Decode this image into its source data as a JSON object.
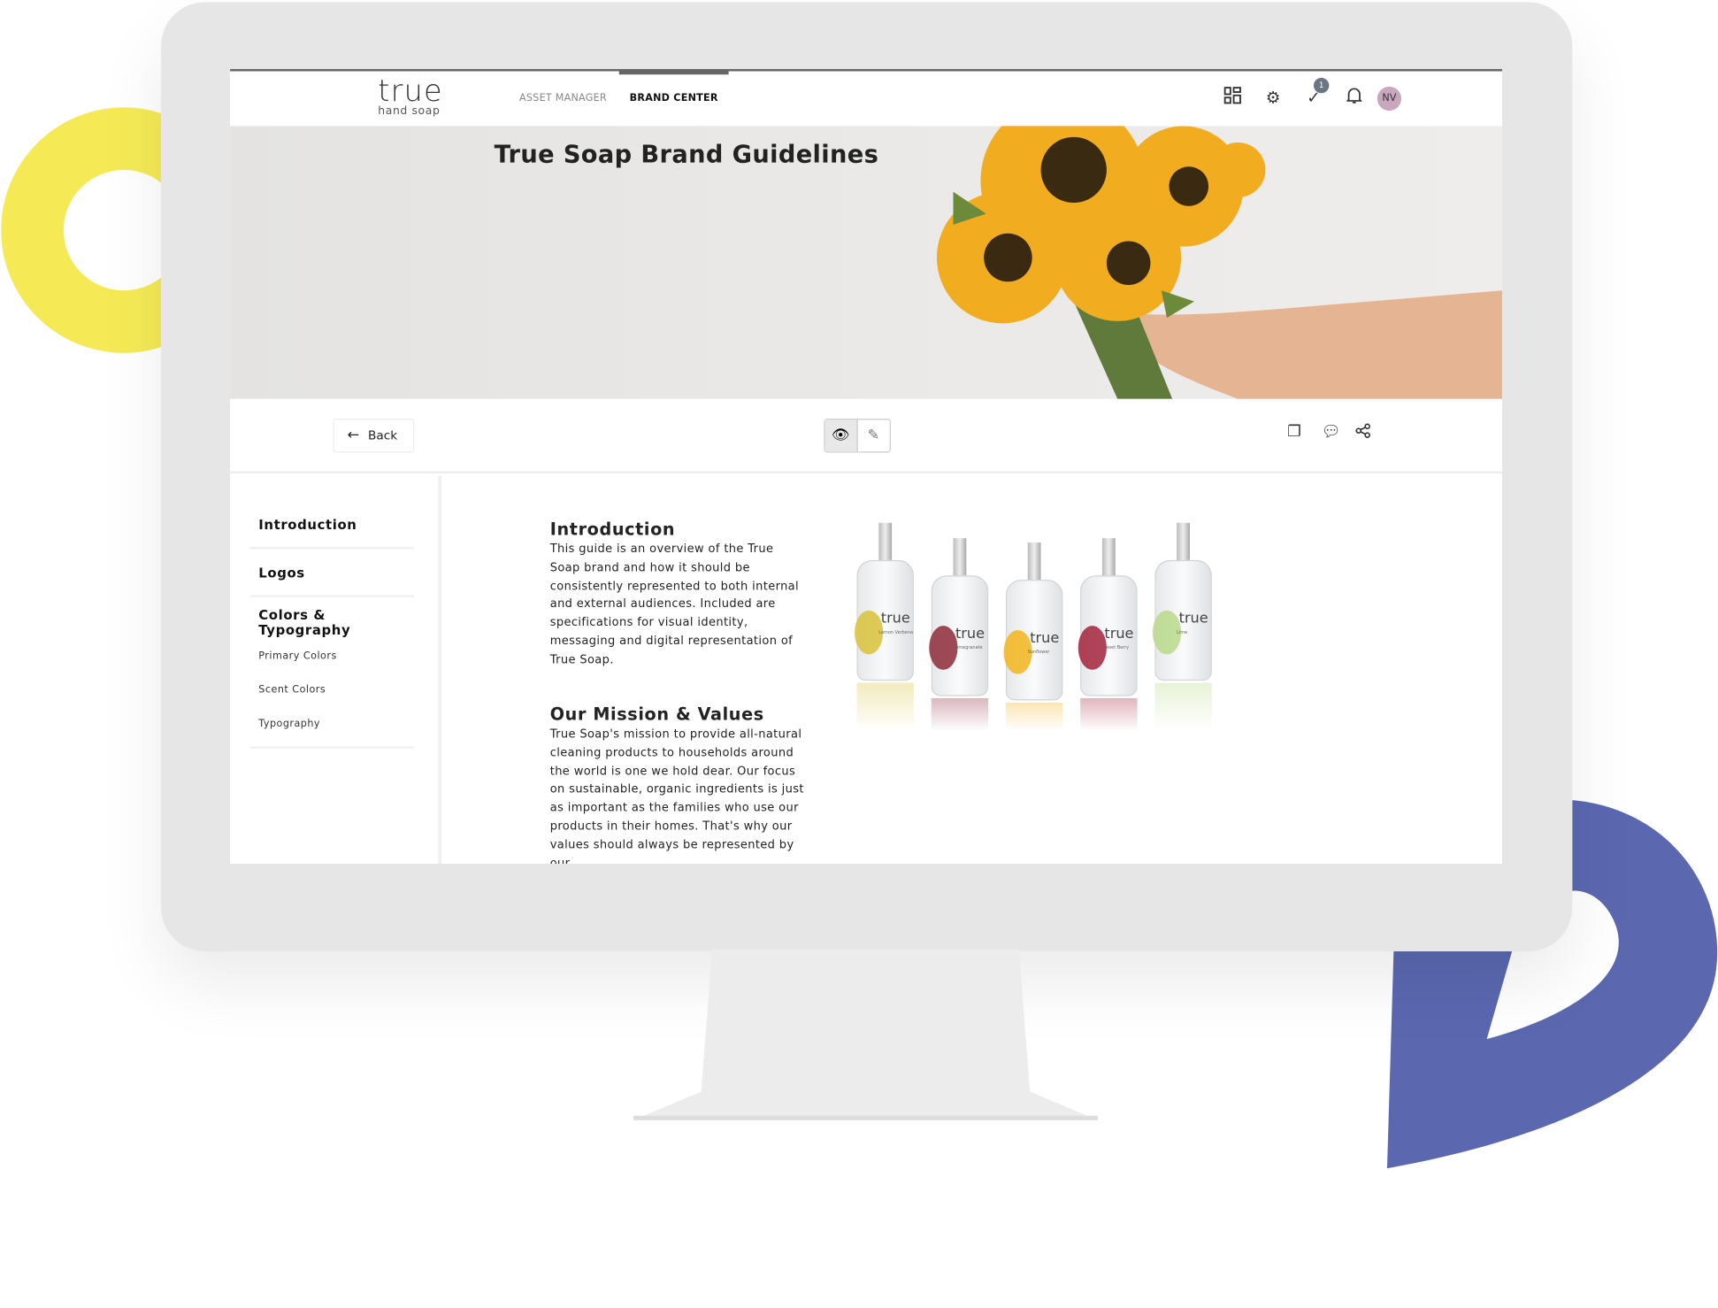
{
  "header": {
    "logo_word": "true",
    "logo_sub": "hand soap",
    "nav": [
      {
        "label": "ASSET MANAGER",
        "active": false
      },
      {
        "label": "BRAND CENTER",
        "active": true
      }
    ],
    "icons": [
      "apps-grid-icon",
      "gear-icon",
      "tasks-check-icon",
      "bell-icon"
    ],
    "tasks_badge": "1",
    "avatar_initials": "NV"
  },
  "hero": {
    "title": "True Soap Brand Guidelines"
  },
  "toolbar": {
    "back_label": "Back",
    "view_mode": "view",
    "icons": [
      "eye-icon",
      "pencil-icon",
      "copy-icon",
      "comment-icon",
      "share-icon"
    ]
  },
  "sidebar": {
    "items": [
      {
        "label": "Introduction"
      },
      {
        "label": "Logos"
      },
      {
        "label": "Colors & Typography",
        "children": [
          "Primary Colors",
          "Scent Colors",
          "Typography"
        ]
      }
    ]
  },
  "content": {
    "sections": [
      {
        "title": "Introduction",
        "body": "This guide is an overview of the True Soap brand and how it should be consistently represented to both internal and external audiences. Included are specifications for visual identity, messaging and digital representation of True Soap."
      },
      {
        "title": "Our Mission & Values",
        "body": "True Soap's mission to provide all-natural cleaning products to households around the world is one we hold dear. Our focus on sustainable, organic ingredients is just as important as the families who use our products in their homes. That's why our values should always be represented by our"
      }
    ],
    "bottles": [
      {
        "label": "true",
        "scent": "Lemon Verbena",
        "color": "#d9c23a"
      },
      {
        "label": "true",
        "scent": "Pomegranate",
        "color": "#8e2a3a"
      },
      {
        "label": "true",
        "scent": "Sunflower",
        "color": "#f2b51c"
      },
      {
        "label": "true",
        "scent": "Sweet Berry",
        "color": "#a3233b"
      },
      {
        "label": "true",
        "scent": "Lime",
        "color": "#b9d98a"
      }
    ]
  },
  "colors": {
    "yellow_ring": "#f5ea55",
    "blue_shape": "#5b68b0",
    "avatar": "#c8a7bf",
    "bezel": "#e6e6e6"
  }
}
